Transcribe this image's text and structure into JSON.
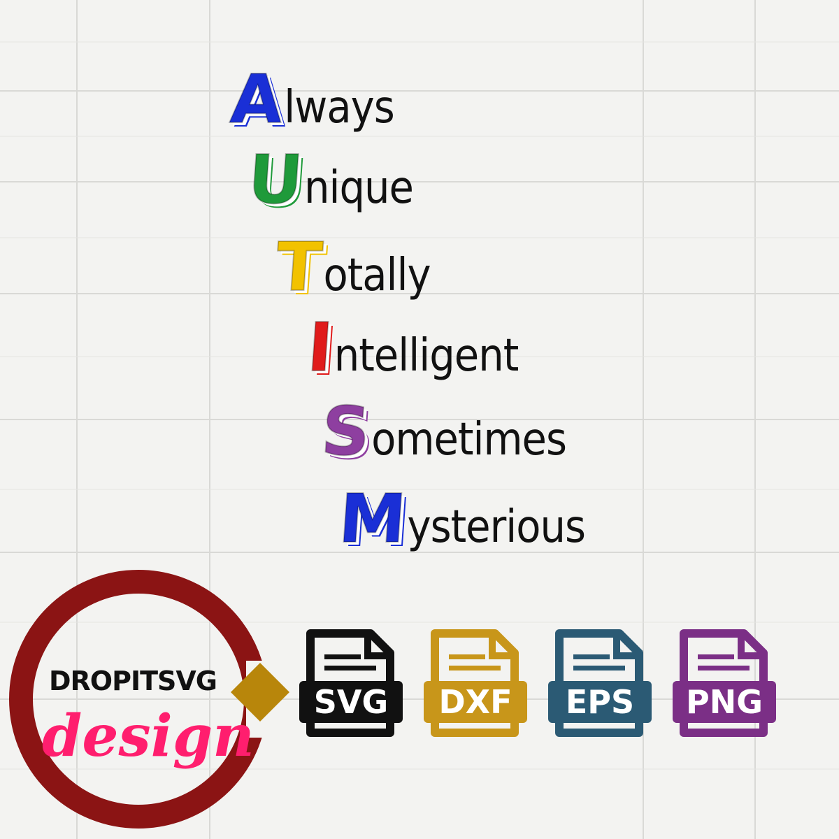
{
  "acronym": {
    "lines": [
      {
        "initial": "A",
        "rest": "lways",
        "color": "#1a2fd6"
      },
      {
        "initial": "U",
        "rest": "nique",
        "color": "#1f9a3a"
      },
      {
        "initial": "T",
        "rest": "otally",
        "color": "#f2c200"
      },
      {
        "initial": "I",
        "rest": "ntelligent",
        "color": "#e01b1b"
      },
      {
        "initial": "S",
        "rest": "ometimes",
        "color": "#8e3fa0"
      },
      {
        "initial": "M",
        "rest": "ysterious",
        "color": "#1a2fd6"
      }
    ]
  },
  "logo": {
    "brand": "DROPITSVG",
    "script": "design",
    "ring_color": "#8b1414",
    "tag_color": "#b8860b",
    "script_color": "#ff1e6e"
  },
  "formats": [
    {
      "label": "SVG",
      "color": "#111111",
      "icon": "file-icon"
    },
    {
      "label": "DXF",
      "color": "#c8961a",
      "icon": "file-icon"
    },
    {
      "label": "EPS",
      "color": "#2b5a74",
      "icon": "file-icon"
    },
    {
      "label": "PNG",
      "color": "#7b2f86",
      "icon": "file-icon"
    }
  ]
}
